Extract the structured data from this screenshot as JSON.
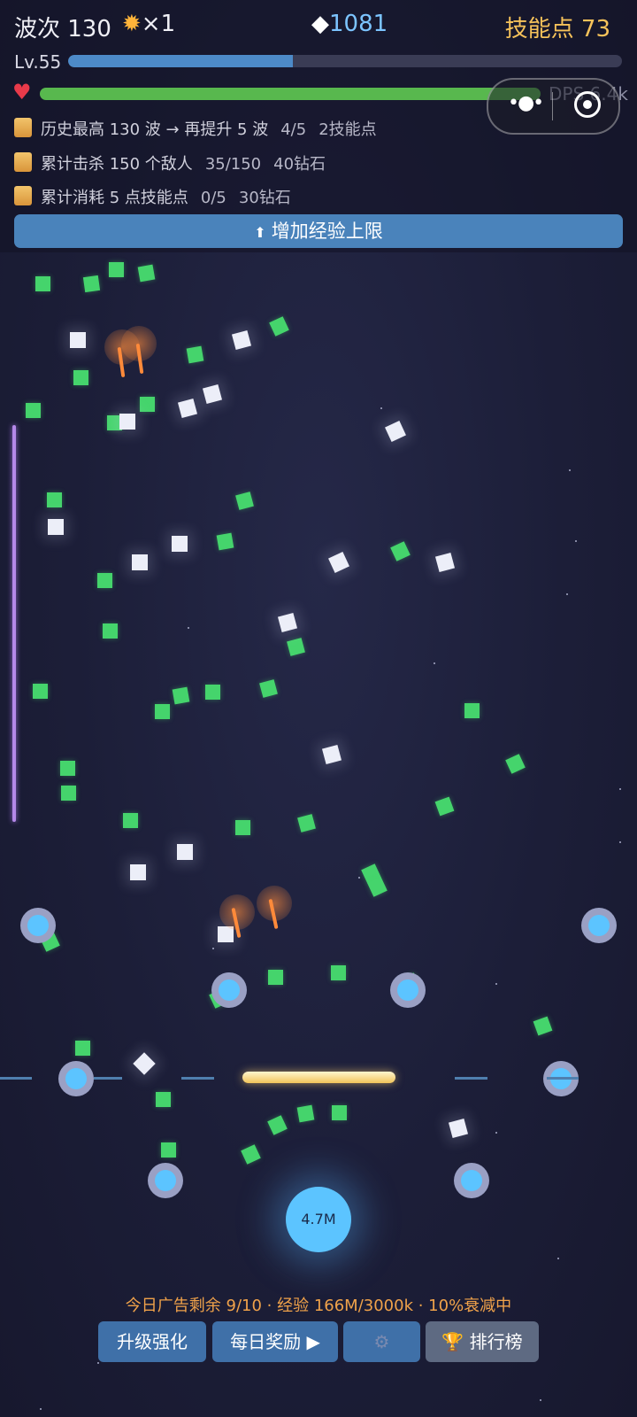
{
  "hud": {
    "wave": "波次 130",
    "multiplier": "×1",
    "gems": "1081",
    "skill_points": "技能点 73",
    "level": "Lv.55",
    "xp_progress": 0.405,
    "hp_progress": 1.0,
    "dps": "DPS 6.4k"
  },
  "quests": [
    {
      "text": "历史最高 130 波 → 再提升 5 波",
      "progress": "4/5",
      "reward": "2技能点"
    },
    {
      "text": "累计击杀 150 个敌人",
      "progress": "35/150",
      "reward": "40钻石"
    },
    {
      "text": "累计消耗 5 点技能点",
      "progress": "0/5",
      "reward": "30钻石"
    }
  ],
  "upgrade_button": "增加经验上限",
  "core_value": "4.7M",
  "info_line": "今日广告剩余 9/10 · 经验 166M/3000k · 10%衰减中",
  "buttons": {
    "upgrade": "升级强化",
    "daily": "每日奖励 ▶",
    "ranking": "排行榜"
  },
  "icons": [
    "sun-icon",
    "diamond-icon",
    "heart-icon",
    "scroll-icon",
    "up-arrow-icon",
    "more-icon",
    "target-icon",
    "gear-icon",
    "trophy-icon"
  ],
  "colors": {
    "enemy_green": "#45d46c",
    "enemy_white": "#eceef8",
    "turret": "#5cc4ff",
    "skill_points": "#f6c25a",
    "gems": "#7cc4ff"
  }
}
